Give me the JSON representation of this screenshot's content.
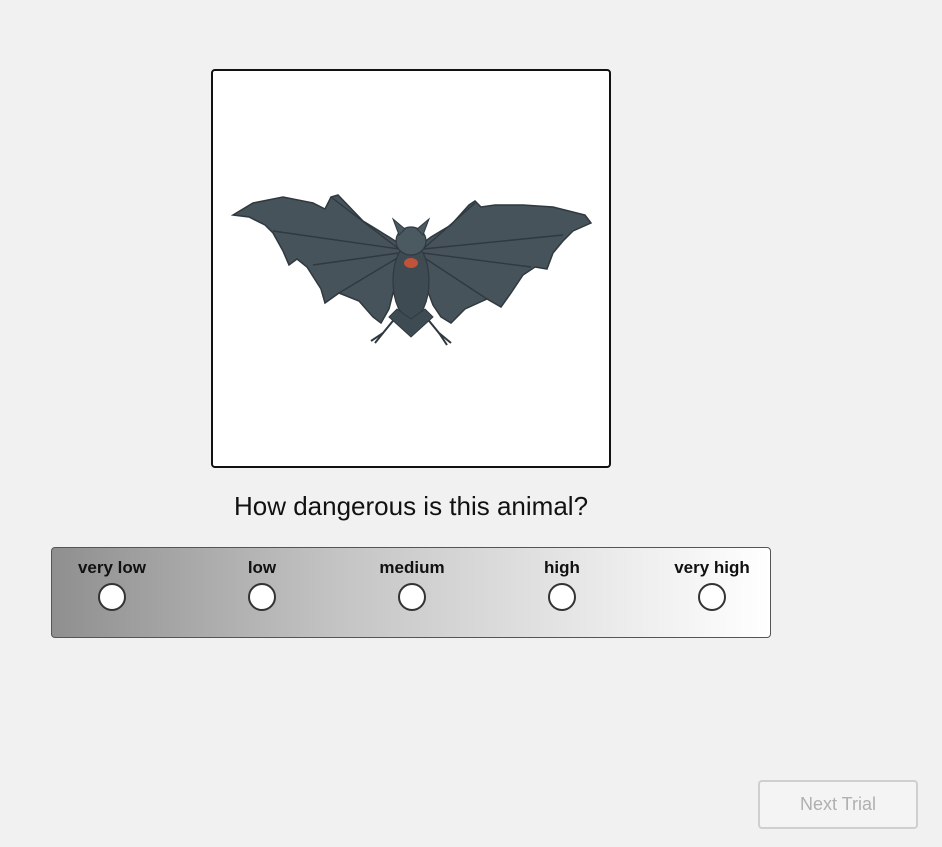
{
  "stimulus": {
    "image_icon": "bat-image",
    "colors": {
      "frame_border": "#111111",
      "bat_body": "#46535a",
      "bat_shadow": "#2f393f",
      "bat_highlight": "#6b7a82",
      "bat_mouth": "#c0533a"
    }
  },
  "question": {
    "text": "How dangerous is this animal?"
  },
  "rating_scale": {
    "options": [
      {
        "label": "very low",
        "selected": false
      },
      {
        "label": "low",
        "selected": false
      },
      {
        "label": "medium",
        "selected": false
      },
      {
        "label": "high",
        "selected": false
      },
      {
        "label": "very high",
        "selected": false
      }
    ],
    "gradient": [
      "#8f8f8f",
      "#ffffff"
    ]
  },
  "footer": {
    "next_button_label": "Next Trial",
    "next_button_enabled": false
  }
}
